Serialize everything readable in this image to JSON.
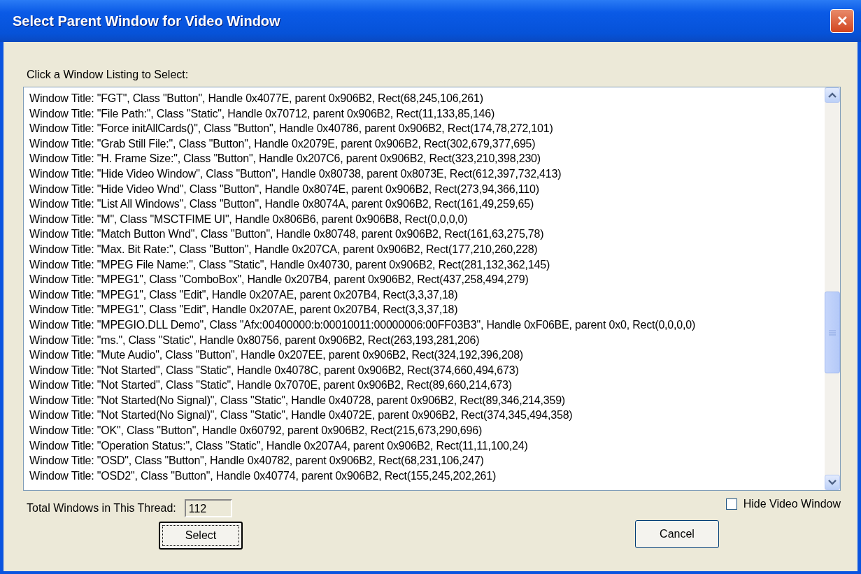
{
  "window": {
    "title": "Select Parent Window for Video Window",
    "close": "✕"
  },
  "list_label": "Click a Window Listing to Select:",
  "listing": [
    "Window Title: \"FGT\", Class \"Button\", Handle 0x4077E, parent 0x906B2, Rect(68,245,106,261)",
    "Window Title: \"File Path:\", Class \"Static\", Handle 0x70712, parent 0x906B2, Rect(11,133,85,146)",
    "Window Title: \"Force initAllCards()\", Class \"Button\", Handle 0x40786, parent 0x906B2, Rect(174,78,272,101)",
    "Window Title: \"Grab Still File:\", Class \"Button\", Handle 0x2079E, parent 0x906B2, Rect(302,679,377,695)",
    "Window Title: \"H. Frame Size:\", Class \"Button\", Handle 0x207C6, parent 0x906B2, Rect(323,210,398,230)",
    "Window Title: \"Hide Video Window\", Class \"Button\", Handle 0x80738, parent 0x8073E, Rect(612,397,732,413)",
    "Window Title: \"Hide Video Wnd\", Class \"Button\", Handle 0x8074E, parent 0x906B2, Rect(273,94,366,110)",
    "Window Title: \"List All Windows\", Class \"Button\", Handle 0x8074A, parent 0x906B2, Rect(161,49,259,65)",
    "Window Title: \"M\", Class \"MSCTFIME UI\", Handle 0x806B6, parent 0x906B8, Rect(0,0,0,0)",
    "Window Title: \"Match Button Wnd\", Class \"Button\", Handle 0x80748, parent 0x906B2, Rect(161,63,275,78)",
    "Window Title: \"Max. Bit Rate:\", Class \"Button\", Handle 0x207CA, parent 0x906B2, Rect(177,210,260,228)",
    "Window Title: \"MPEG File Name:\", Class \"Static\", Handle 0x40730, parent 0x906B2, Rect(281,132,362,145)",
    "Window Title: \"MPEG1\", Class \"ComboBox\", Handle 0x207B4, parent 0x906B2, Rect(437,258,494,279)",
    "Window Title: \"MPEG1\", Class \"Edit\", Handle 0x207AE, parent 0x207B4, Rect(3,3,37,18)",
    "Window Title: \"MPEG1\", Class \"Edit\", Handle 0x207AE, parent 0x207B4, Rect(3,3,37,18)",
    "Window Title: \"MPEGIO.DLL Demo\", Class \"Afx:00400000:b:00010011:00000006:00FF03B3\", Handle 0xF06BE, parent 0x0, Rect(0,0,0,0)",
    "Window Title: \"ms.\", Class \"Static\", Handle 0x80756, parent 0x906B2, Rect(263,193,281,206)",
    "Window Title: \"Mute Audio\", Class \"Button\", Handle 0x207EE, parent 0x906B2, Rect(324,192,396,208)",
    "Window Title: \"Not Started\", Class \"Static\", Handle 0x4078C, parent 0x906B2, Rect(374,660,494,673)",
    "Window Title: \"Not Started\", Class \"Static\", Handle 0x7070E, parent 0x906B2, Rect(89,660,214,673)",
    "Window Title: \"Not Started(No Signal)\", Class \"Static\", Handle 0x40728, parent 0x906B2, Rect(89,346,214,359)",
    "Window Title: \"Not Started(No Signal)\", Class \"Static\", Handle 0x4072E, parent 0x906B2, Rect(374,345,494,358)",
    "Window Title: \"OK\", Class \"Button\", Handle 0x60792, parent 0x906B2, Rect(215,673,290,696)",
    "Window Title: \"Operation Status:\", Class \"Static\", Handle 0x207A4, parent 0x906B2, Rect(11,11,100,24)",
    "Window Title: \"OSD\", Class \"Button\", Handle 0x40782, parent 0x906B2, Rect(68,231,106,247)",
    "Window Title: \"OSD2\", Class \"Button\", Handle 0x40774, parent 0x906B2, Rect(155,245,202,261)"
  ],
  "total_label": "Total Windows in This Thread:",
  "total_value": "112",
  "hide_video_window": {
    "label": "Hide Video Window",
    "checked": false
  },
  "buttons": [
    {
      "label": "Select",
      "focused": true
    },
    {
      "label": "Cancel",
      "focused": false
    }
  ]
}
